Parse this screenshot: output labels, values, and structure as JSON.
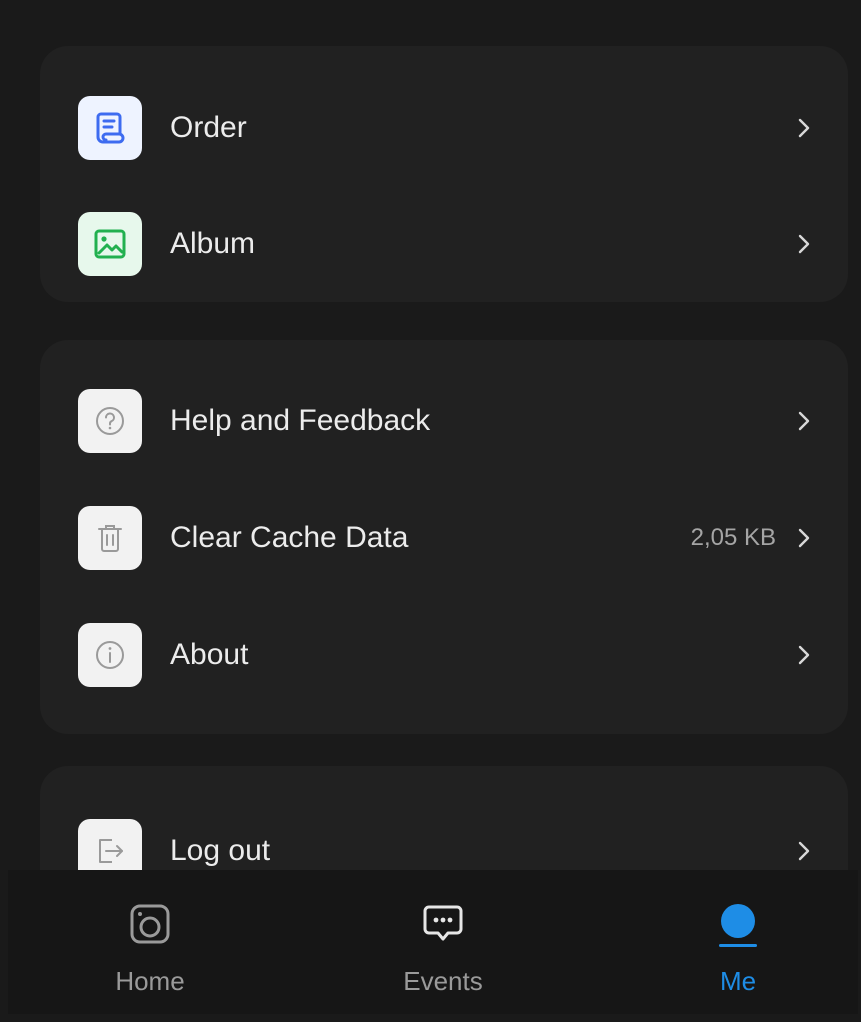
{
  "sections": [
    {
      "items": [
        {
          "label": "Order",
          "icon": "order-icon"
        },
        {
          "label": "Album",
          "icon": "album-icon"
        }
      ]
    },
    {
      "items": [
        {
          "label": "Help and Feedback",
          "icon": "help-icon"
        },
        {
          "label": "Clear Cache Data",
          "icon": "trash-icon",
          "value": "2,05 KB"
        },
        {
          "label": "About",
          "icon": "info-icon"
        }
      ]
    },
    {
      "items": [
        {
          "label": "Log out",
          "icon": "logout-icon"
        }
      ]
    }
  ],
  "tabs": [
    {
      "label": "Home",
      "icon": "camera-icon",
      "active": false
    },
    {
      "label": "Events",
      "icon": "chat-icon",
      "active": false
    },
    {
      "label": "Me",
      "icon": "user-icon",
      "active": true
    }
  ],
  "colors": {
    "background": "#1a1a1a",
    "card": "#212121",
    "accent": "#1e8de6",
    "order_tile": "#eef3ff",
    "order_icon": "#3d6bf0",
    "album_tile": "#e7f8ec",
    "album_icon": "#22b04f"
  }
}
